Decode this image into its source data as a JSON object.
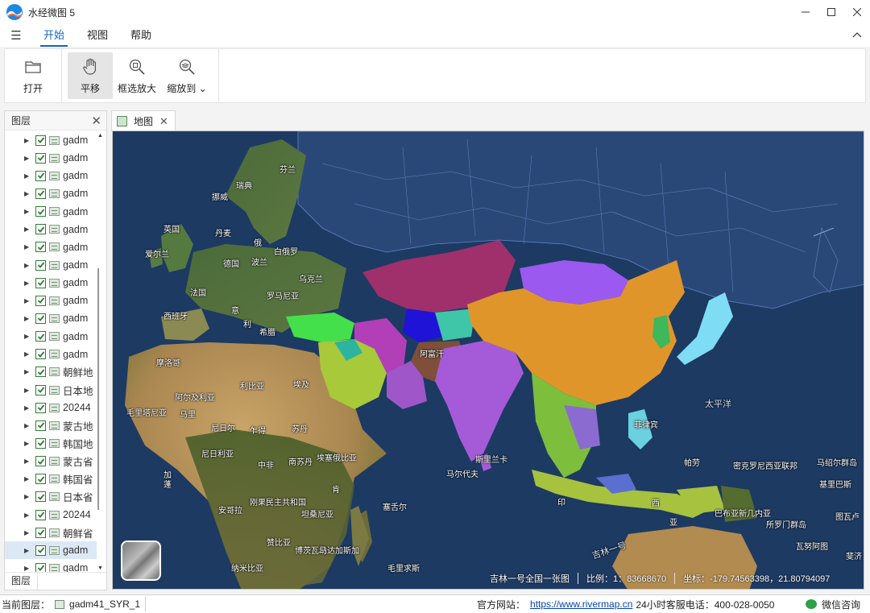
{
  "app": {
    "title": "水经微图 5"
  },
  "window": {
    "minimize_icon": "minimize-icon",
    "maximize_icon": "maximize-icon",
    "close_icon": "close-icon"
  },
  "menu": {
    "tabs": [
      {
        "label": "开始",
        "active": true
      },
      {
        "label": "视图",
        "active": false
      },
      {
        "label": "帮助",
        "active": false
      }
    ]
  },
  "ribbon": {
    "open": "打开",
    "pan": "平移",
    "box_zoom": "框选放大",
    "zoom_to": "缩放到",
    "zoom_to_arrow": "⌄"
  },
  "layer_panel": {
    "title": "图层",
    "footer_tab": "图层",
    "layers": [
      {
        "name": "gadm",
        "checked": true
      },
      {
        "name": "gadm",
        "checked": true
      },
      {
        "name": "gadm",
        "checked": true
      },
      {
        "name": "gadm",
        "checked": true
      },
      {
        "name": "gadm",
        "checked": true
      },
      {
        "name": "gadm",
        "checked": true
      },
      {
        "name": "gadm",
        "checked": true
      },
      {
        "name": "gadm",
        "checked": true
      },
      {
        "name": "gadm",
        "checked": true
      },
      {
        "name": "gadm",
        "checked": true
      },
      {
        "name": "gadm",
        "checked": true
      },
      {
        "name": "gadm",
        "checked": true
      },
      {
        "name": "gadm",
        "checked": true
      },
      {
        "name": "朝鲜地",
        "checked": true
      },
      {
        "name": "日本地",
        "checked": true
      },
      {
        "name": "20244",
        "checked": true
      },
      {
        "name": "蒙古地",
        "checked": true
      },
      {
        "name": "韩国地",
        "checked": true
      },
      {
        "name": "蒙古省",
        "checked": true
      },
      {
        "name": "韩国省",
        "checked": true
      },
      {
        "name": "日本省",
        "checked": true
      },
      {
        "name": "20244",
        "checked": true
      },
      {
        "name": "朝鲜省",
        "checked": true
      },
      {
        "name": "gadm",
        "checked": true,
        "selected": true
      },
      {
        "name": "gadm",
        "checked": true
      }
    ]
  },
  "map_tab": {
    "label": "地图"
  },
  "map": {
    "labels": [
      {
        "text": "芬兰"
      },
      {
        "text": "瑞典"
      },
      {
        "text": "挪威"
      },
      {
        "text": "英国"
      },
      {
        "text": "丹麦"
      },
      {
        "text": "俄"
      },
      {
        "text": "爱尔兰"
      },
      {
        "text": "白俄罗"
      },
      {
        "text": "德国"
      },
      {
        "text": "波兰"
      },
      {
        "text": "乌克兰"
      },
      {
        "text": "法国"
      },
      {
        "text": "罗马尼亚"
      },
      {
        "text": "西班牙"
      },
      {
        "text": "意"
      },
      {
        "text": "利"
      },
      {
        "text": "希腊"
      },
      {
        "text": "阿富汗"
      },
      {
        "text": "摩洛哥"
      },
      {
        "text": "阿尔及利亚"
      },
      {
        "text": "利比亚"
      },
      {
        "text": "埃及"
      },
      {
        "text": "毛里塔尼亚"
      },
      {
        "text": "马里"
      },
      {
        "text": "尼日尔"
      },
      {
        "text": "乍得"
      },
      {
        "text": "苏丹"
      },
      {
        "text": "尼日利亚"
      },
      {
        "text": "中非"
      },
      {
        "text": "南苏丹"
      },
      {
        "text": "埃塞俄比亚"
      },
      {
        "text": "加"
      },
      {
        "text": "蓬"
      },
      {
        "text": "刚果民主共和国"
      },
      {
        "text": "坦桑尼亚"
      },
      {
        "text": "肯"
      },
      {
        "text": "安哥拉"
      },
      {
        "text": "赞比亚"
      },
      {
        "text": "纳米比亚"
      },
      {
        "text": "博茨瓦纳"
      },
      {
        "text": "马达加斯加"
      },
      {
        "text": "塞舌尔"
      },
      {
        "text": "毛里求斯"
      },
      {
        "text": "马尔代夫"
      },
      {
        "text": "斯里兰卡"
      },
      {
        "text": "菲律宾"
      },
      {
        "text": "帕劳"
      },
      {
        "text": "密克罗尼西亚联邦"
      },
      {
        "text": "马绍尔群岛"
      },
      {
        "text": "基里巴斯"
      },
      {
        "text": "巴布亚新几内亚"
      },
      {
        "text": "所罗门群岛"
      },
      {
        "text": "图瓦卢"
      },
      {
        "text": "瓦努阿图"
      },
      {
        "text": "斐济"
      },
      {
        "text": "太平洋"
      },
      {
        "text": "印"
      },
      {
        "text": "西"
      },
      {
        "text": "亚"
      },
      {
        "text": "吉林一号"
      }
    ],
    "attribution": "吉林一号全国一张图",
    "scale_label": "比例：1：83668670",
    "coords_label": "坐标：-179.74563398，21.80794097"
  },
  "statusbar": {
    "current_layer_label": "当前图层：",
    "current_layer": "gadm41_SYR_1",
    "website_label": "官方网站：",
    "website_url": "https://www.rivermap.cn",
    "phone": "24小时客服电话：400-028-0050",
    "wechat": "微信咨询"
  },
  "colors": {
    "accent": "#1565c0",
    "checkbox": "#2e7d32",
    "ocean": "#1d3a63"
  }
}
